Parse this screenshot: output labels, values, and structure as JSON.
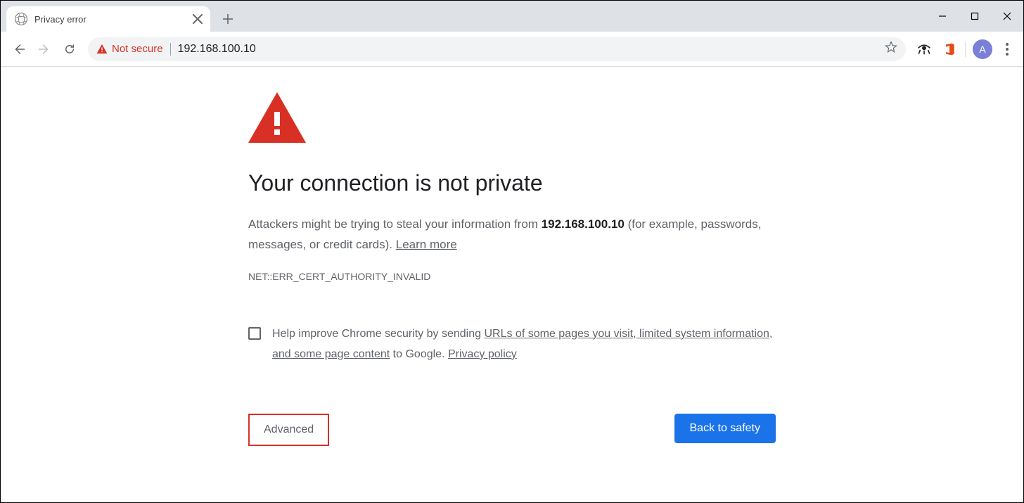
{
  "tab": {
    "title": "Privacy error"
  },
  "toolbar": {
    "security_label": "Not secure",
    "url": "192.168.100.10",
    "profile_initial": "A"
  },
  "page": {
    "heading": "Your connection is not private",
    "body_prefix": "Attackers might be trying to steal your information from ",
    "host": "192.168.100.10",
    "body_suffix": " (for example, passwords, messages, or credit cards). ",
    "learn_more": "Learn more",
    "error_code": "NET::ERR_CERT_AUTHORITY_INVALID",
    "optin_prefix": "Help improve Chrome security by sending ",
    "optin_link1": "URLs of some pages you visit, limited system information, and some page content",
    "optin_mid": " to Google. ",
    "optin_link2": "Privacy policy",
    "advanced_label": "Advanced",
    "back_label": "Back to safety"
  }
}
